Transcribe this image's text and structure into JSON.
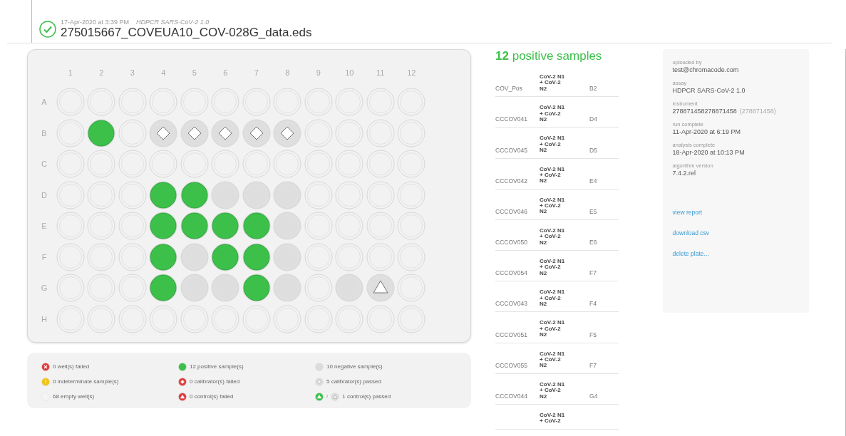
{
  "header": {
    "passed": true,
    "date": "17-Apr-2020 at 3:39 PM",
    "assay": "HDPCR SARS-CoV-2 1.0",
    "filename": "275015667_COVEUA10_COV-028G_data.eds"
  },
  "plate": {
    "columns": [
      "1",
      "2",
      "3",
      "4",
      "5",
      "6",
      "7",
      "8",
      "9",
      "10",
      "11",
      "12"
    ],
    "rows": [
      {
        "label": "A",
        "wells": [
          {
            "kind": "empty"
          },
          {
            "kind": "empty"
          },
          {
            "kind": "empty"
          },
          {
            "kind": "empty"
          },
          {
            "kind": "empty"
          },
          {
            "kind": "empty"
          },
          {
            "kind": "empty"
          },
          {
            "kind": "empty"
          },
          {
            "kind": "empty"
          },
          {
            "kind": "empty"
          },
          {
            "kind": "empty"
          },
          {
            "kind": "empty"
          }
        ]
      },
      {
        "label": "B",
        "wells": [
          {
            "kind": "empty"
          },
          {
            "kind": "positive"
          },
          {
            "kind": "empty"
          },
          {
            "kind": "calibrator"
          },
          {
            "kind": "calibrator"
          },
          {
            "kind": "calibrator"
          },
          {
            "kind": "calibrator"
          },
          {
            "kind": "calibrator"
          },
          {
            "kind": "empty"
          },
          {
            "kind": "empty"
          },
          {
            "kind": "empty"
          },
          {
            "kind": "empty"
          }
        ]
      },
      {
        "label": "C",
        "wells": [
          {
            "kind": "empty"
          },
          {
            "kind": "empty"
          },
          {
            "kind": "empty"
          },
          {
            "kind": "empty"
          },
          {
            "kind": "empty"
          },
          {
            "kind": "empty"
          },
          {
            "kind": "empty"
          },
          {
            "kind": "empty"
          },
          {
            "kind": "empty"
          },
          {
            "kind": "empty"
          },
          {
            "kind": "empty"
          },
          {
            "kind": "empty"
          }
        ]
      },
      {
        "label": "D",
        "wells": [
          {
            "kind": "empty"
          },
          {
            "kind": "empty"
          },
          {
            "kind": "empty"
          },
          {
            "kind": "positive"
          },
          {
            "kind": "positive"
          },
          {
            "kind": "negative"
          },
          {
            "kind": "negative"
          },
          {
            "kind": "negative"
          },
          {
            "kind": "empty"
          },
          {
            "kind": "empty"
          },
          {
            "kind": "empty"
          },
          {
            "kind": "empty"
          }
        ]
      },
      {
        "label": "E",
        "wells": [
          {
            "kind": "empty"
          },
          {
            "kind": "empty"
          },
          {
            "kind": "empty"
          },
          {
            "kind": "positive"
          },
          {
            "kind": "positive"
          },
          {
            "kind": "positive"
          },
          {
            "kind": "positive"
          },
          {
            "kind": "negative"
          },
          {
            "kind": "empty"
          },
          {
            "kind": "empty"
          },
          {
            "kind": "empty"
          },
          {
            "kind": "empty"
          }
        ]
      },
      {
        "label": "F",
        "wells": [
          {
            "kind": "empty"
          },
          {
            "kind": "empty"
          },
          {
            "kind": "empty"
          },
          {
            "kind": "positive"
          },
          {
            "kind": "negative"
          },
          {
            "kind": "positive"
          },
          {
            "kind": "positive"
          },
          {
            "kind": "negative"
          },
          {
            "kind": "empty"
          },
          {
            "kind": "empty"
          },
          {
            "kind": "empty"
          },
          {
            "kind": "empty"
          }
        ]
      },
      {
        "label": "G",
        "wells": [
          {
            "kind": "empty"
          },
          {
            "kind": "empty"
          },
          {
            "kind": "empty"
          },
          {
            "kind": "positive"
          },
          {
            "kind": "negative"
          },
          {
            "kind": "negative"
          },
          {
            "kind": "positive"
          },
          {
            "kind": "negative"
          },
          {
            "kind": "empty"
          },
          {
            "kind": "negative"
          },
          {
            "kind": "control"
          },
          {
            "kind": "empty"
          }
        ]
      },
      {
        "label": "H",
        "wells": [
          {
            "kind": "empty"
          },
          {
            "kind": "empty"
          },
          {
            "kind": "empty"
          },
          {
            "kind": "empty"
          },
          {
            "kind": "empty"
          },
          {
            "kind": "empty"
          },
          {
            "kind": "empty"
          },
          {
            "kind": "empty"
          },
          {
            "kind": "empty"
          },
          {
            "kind": "empty"
          },
          {
            "kind": "empty"
          },
          {
            "kind": "empty"
          }
        ]
      }
    ]
  },
  "legend": [
    {
      "kind": "failed",
      "text": "0 well(s) failed"
    },
    {
      "kind": "positive",
      "text": "12 positive sample(s)"
    },
    {
      "kind": "negative",
      "text": "10 negative sample(s)"
    },
    {
      "kind": "indeterminate",
      "text": "0 indeterminate sample(s)"
    },
    {
      "kind": "calibrator-failed",
      "text": "0 calibrator(s) failed"
    },
    {
      "kind": "calibrator",
      "text": "5 calibrator(s) passed"
    },
    {
      "kind": "empty",
      "text": "68 empty well(s)"
    },
    {
      "kind": "control-failed",
      "text": "0 control(s) failed"
    },
    {
      "kind": "control-passed",
      "text": "1 control(s) passed",
      "separator": "/"
    }
  ],
  "samples": {
    "count": "12",
    "title": "positive samples",
    "rows": [
      {
        "name": "COV_Pos",
        "target": "CoV-2 N1 + CoV-2 N2",
        "well": "B2"
      },
      {
        "name": "CCCOV041",
        "target": "CoV-2 N1 + CoV-2 N2",
        "well": "D4"
      },
      {
        "name": "CCCOV045",
        "target": "CoV-2 N1 + CoV-2 N2",
        "well": "D5"
      },
      {
        "name": "CCCOV042",
        "target": "CoV-2 N1 + CoV-2 N2",
        "well": "E4"
      },
      {
        "name": "CCCOV046",
        "target": "CoV-2 N1 + CoV-2 N2",
        "well": "E5"
      },
      {
        "name": "CCCOV050",
        "target": "CoV-2 N1 + CoV-2 N2",
        "well": "E6"
      },
      {
        "name": "CCCOV054",
        "target": "CoV-2 N1 + CoV-2 N2",
        "well": "F7"
      },
      {
        "name": "CCCOV043",
        "target": "CoV-2 N1 + CoV-2 N2",
        "well": "F4"
      },
      {
        "name": "CCCOV051",
        "target": "CoV-2 N1 + CoV-2 N2",
        "well": "F5"
      },
      {
        "name": "CCCOV055",
        "target": "CoV-2 N1 + CoV-2 N2",
        "well": "F7"
      },
      {
        "name": "CCCOV044",
        "target": "CoV-2 N1 + CoV-2 N2",
        "well": "G4"
      },
      {
        "target": "CoV-2 N1 + CoV-2"
      }
    ]
  },
  "info": {
    "fields": [
      {
        "label": "uploaded by",
        "value": "test@chromacode.com"
      },
      {
        "label": "assay",
        "value": "HDPCR SARS-CoV-2 1.0"
      },
      {
        "label": "instrument",
        "value": "278871458278871458",
        "extra": "(278871458)"
      },
      {
        "label": "run complete",
        "value": "11-Apr-2020 at 6:19 PM"
      },
      {
        "label": "analysis complete",
        "value": "18-Apr-2020 at 10:13 PM"
      },
      {
        "label": "algorithm version",
        "value": "7.4.2.rel"
      }
    ],
    "links": [
      "view report",
      "download csv",
      "delete plate..."
    ]
  }
}
